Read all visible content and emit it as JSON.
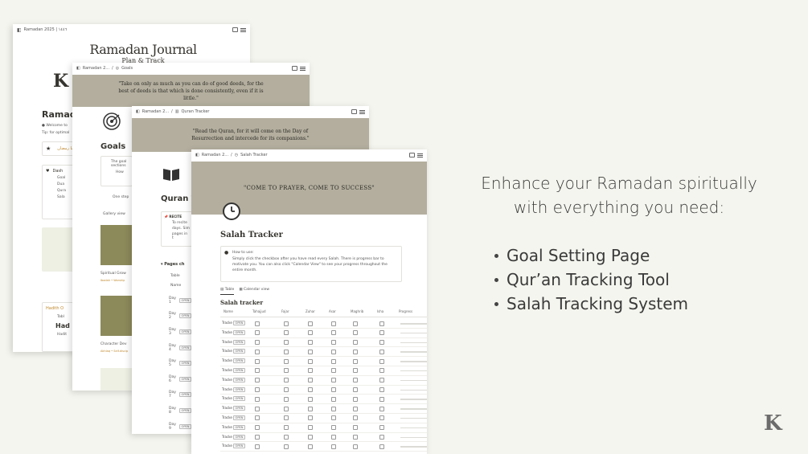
{
  "journal": {
    "breadcrumb": "Ramadan 2025 | ١٤٤٦",
    "title": "Ramadan Journal",
    "subtitle": "Plan & Track",
    "heading": "Ramadan",
    "welcome": "Welcome to",
    "tip": "Tip: for optimal",
    "arabic_link": "ما رمضان",
    "dash": "Dash",
    "dash_items": [
      "Goal",
      "Dua",
      "Qura",
      "Sala"
    ],
    "hadith": "Hadith O",
    "table": "Tabl",
    "had": "Had",
    "hadit_small": "Hadit"
  },
  "goals": {
    "crumb1": "Ramadan 2...",
    "crumb2": "Goals",
    "quote": "\"Take on only as much as you can do of good deeds, for the best of deeds is that which is done consistently, even if it is little.\"",
    "heading": "Goals",
    "callout1": "The goal",
    "callout2": "sections",
    "how": "How",
    "one_step": "One step",
    "gallery": "Gallery view",
    "card1_title": "Spiritual Grow",
    "card1_tags": "Ibadah • Worship",
    "card2_title": "Character Dev",
    "card2_tags": "Akhlaq • Self-discip"
  },
  "quran": {
    "crumb1": "Ramadan 2...",
    "crumb2": "Quran Tracker",
    "quote": "\"Read the Quran, for it will come on the Day of Resurrection and intercede for its companions.\"",
    "heading": "Quran T",
    "recite": "RECITE",
    "recite_text": [
      "To recite",
      "days. Sim",
      "pages in t"
    ],
    "pages_header": "Pages ch",
    "table": "Table",
    "name_col": "Name",
    "days": [
      "Day 1",
      "Day 2",
      "Day 3",
      "Day 4",
      "Day 5",
      "Day 6",
      "Day 7",
      "Day 8",
      "Day 9"
    ],
    "open": "OPEN"
  },
  "salah": {
    "crumb1": "Ramadan 2...",
    "crumb2": "Salah Tracker",
    "quote": "\"COME TO PRAYER, COME TO SUCCESS\"",
    "heading": "Salah Tracker",
    "how_to": "How to use:",
    "instructions": "Simply click the checkbox after you have read every Salah. There is progress bar to motivate you. You can also click \"Calendar View\" to see your progress throughout the entire month.",
    "tab_table": "Table",
    "tab_calendar": "Calendar view",
    "db_title": "Salah tracker",
    "columns": [
      "Name",
      "Tahajjud",
      "Fajar",
      "Zuhar",
      "Asar",
      "Maghrib",
      "Isha",
      "Progress"
    ],
    "row_label": "Tracke",
    "open": "OPEN",
    "row_count": 14
  },
  "promo": {
    "headline_line1": "Enhance your Ramadan spiritually",
    "headline_line2": "with everything you need:",
    "features": [
      "Goal Setting Page",
      "Qur’an Tracking Tool",
      "Salah Tracking System"
    ]
  },
  "icons": [
    "notion-logo-icon",
    "target-icon",
    "book-icon",
    "clock-icon",
    "brand-logo-icon"
  ],
  "colors": {
    "background": "#f5f5ef",
    "cover": "#b3ae9e",
    "accent": "#c0892e"
  }
}
